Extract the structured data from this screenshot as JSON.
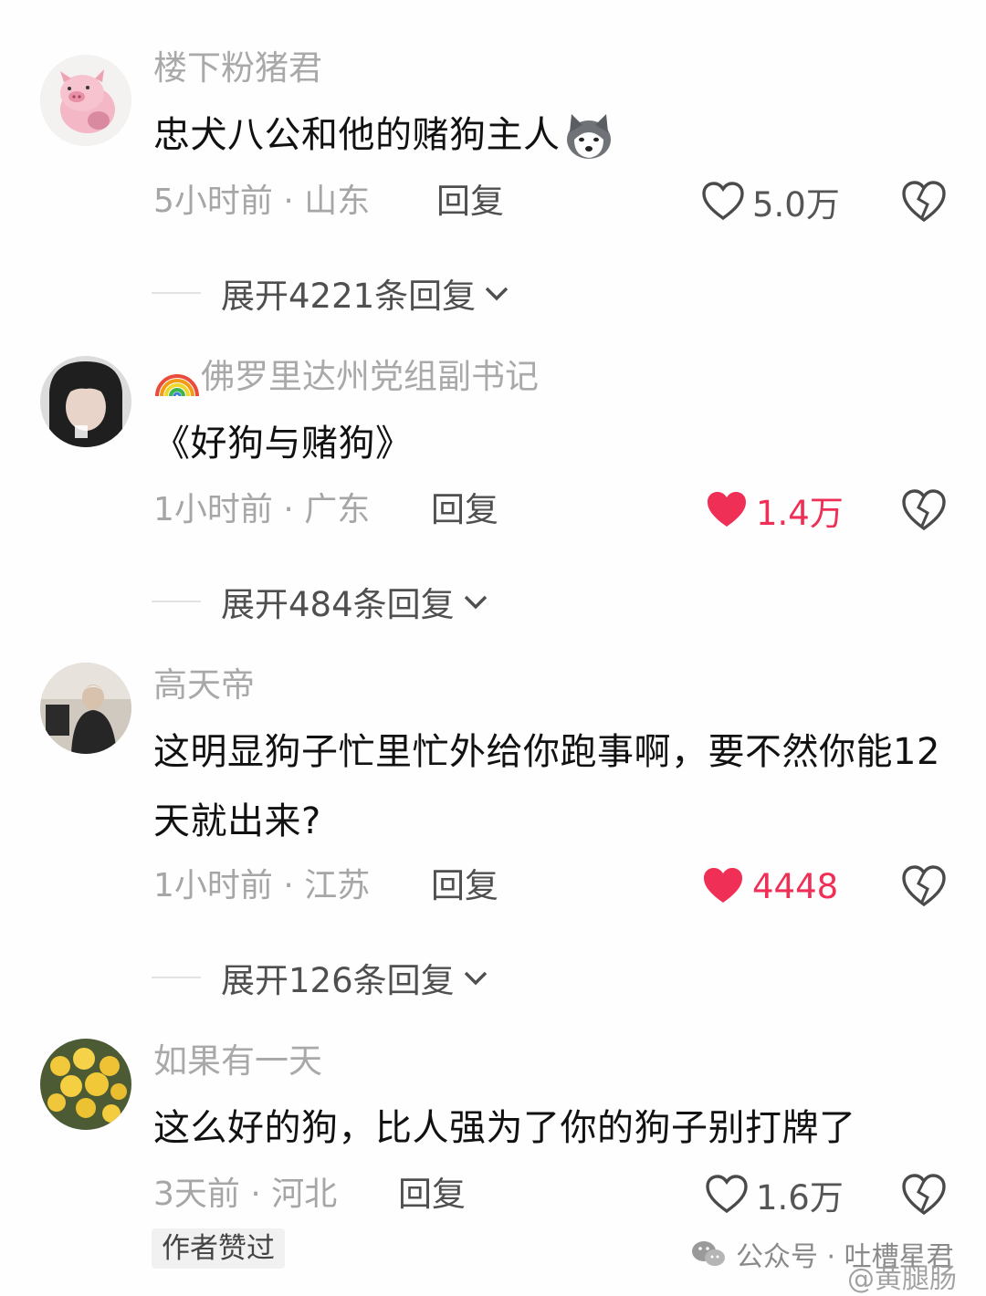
{
  "comments": [
    {
      "username": "楼下粉猪君",
      "text": "忠犬八公和他的赌狗主人",
      "emoji": "husky-dog-emoji",
      "time_location": "5小时前 · 山东",
      "reply_label": "回复",
      "likes": "5.0万",
      "liked": false,
      "expand_label": "展开4221条回复"
    },
    {
      "username": "佛罗里达州党组副书记",
      "username_icon": "rainbow-icon",
      "text": "《好狗与赌狗》",
      "time_location": "1小时前 · 广东",
      "reply_label": "回复",
      "likes": "1.4万",
      "liked": true,
      "expand_label": "展开484条回复"
    },
    {
      "username": "高天帝",
      "text": "这明显狗子忙里忙外给你跑事啊，要不然你能12天就出来?",
      "time_location": "1小时前 · 江苏",
      "reply_label": "回复",
      "likes": "4448",
      "liked": true,
      "expand_label": "展开126条回复"
    },
    {
      "username": "如果有一天",
      "text": "这么好的狗，比人强为了你的狗子别打牌了",
      "time_location": "3天前 · 河北",
      "reply_label": "回复",
      "likes": "1.6万",
      "liked": false,
      "badge": "作者赞过"
    }
  ],
  "watermark": {
    "wechat": "公众号 · 吐槽星君",
    "weibo": "@黄腿肠"
  },
  "colors": {
    "like_red": "#ef2f55",
    "muted": "#a6a6a6",
    "text": "#111111"
  }
}
